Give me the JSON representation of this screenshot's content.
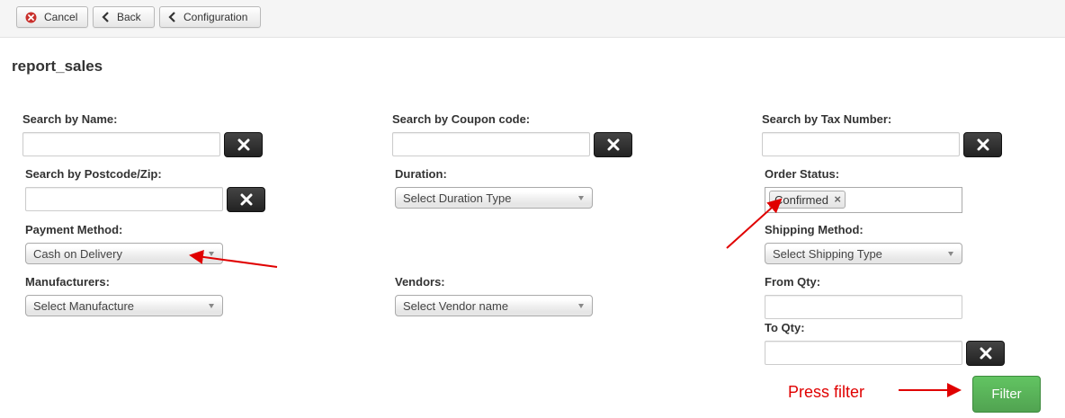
{
  "toolbar": {
    "cancel_label": "Cancel",
    "back_label": "Back",
    "configuration_label": "Configuration"
  },
  "page": {
    "title": "report_sales"
  },
  "filters": {
    "search_name_label": "Search by Name:",
    "search_coupon_label": "Search by Coupon code:",
    "search_tax_label": "Search by Tax Number:",
    "search_postcode_label": "Search by Postcode/Zip:",
    "duration_label": "Duration:",
    "duration_value": "Select Duration Type",
    "order_status_label": "Order Status:",
    "order_status_chip": "Confirmed",
    "payment_method_label": "Payment Method:",
    "payment_method_value": "Cash on Delivery",
    "shipping_method_label": "Shipping Method:",
    "shipping_method_value": "Select Shipping Type",
    "manufacturers_label": "Manufacturers:",
    "manufacturers_value": "Select Manufacture",
    "vendors_label": "Vendors:",
    "vendors_value": "Select Vendor name",
    "from_qty_label": "From Qty:",
    "to_qty_label": "To Qty:",
    "filter_label": "Filter"
  },
  "annotation": {
    "text": "Press filter",
    "color": "#e00000"
  },
  "colors": {
    "filter_button": "#5bb75b",
    "clear_button": "#333333",
    "cancel_icon": "#c9302c"
  },
  "icons": [
    "cancel-circle-icon",
    "chevron-left-icon",
    "close-icon"
  ]
}
